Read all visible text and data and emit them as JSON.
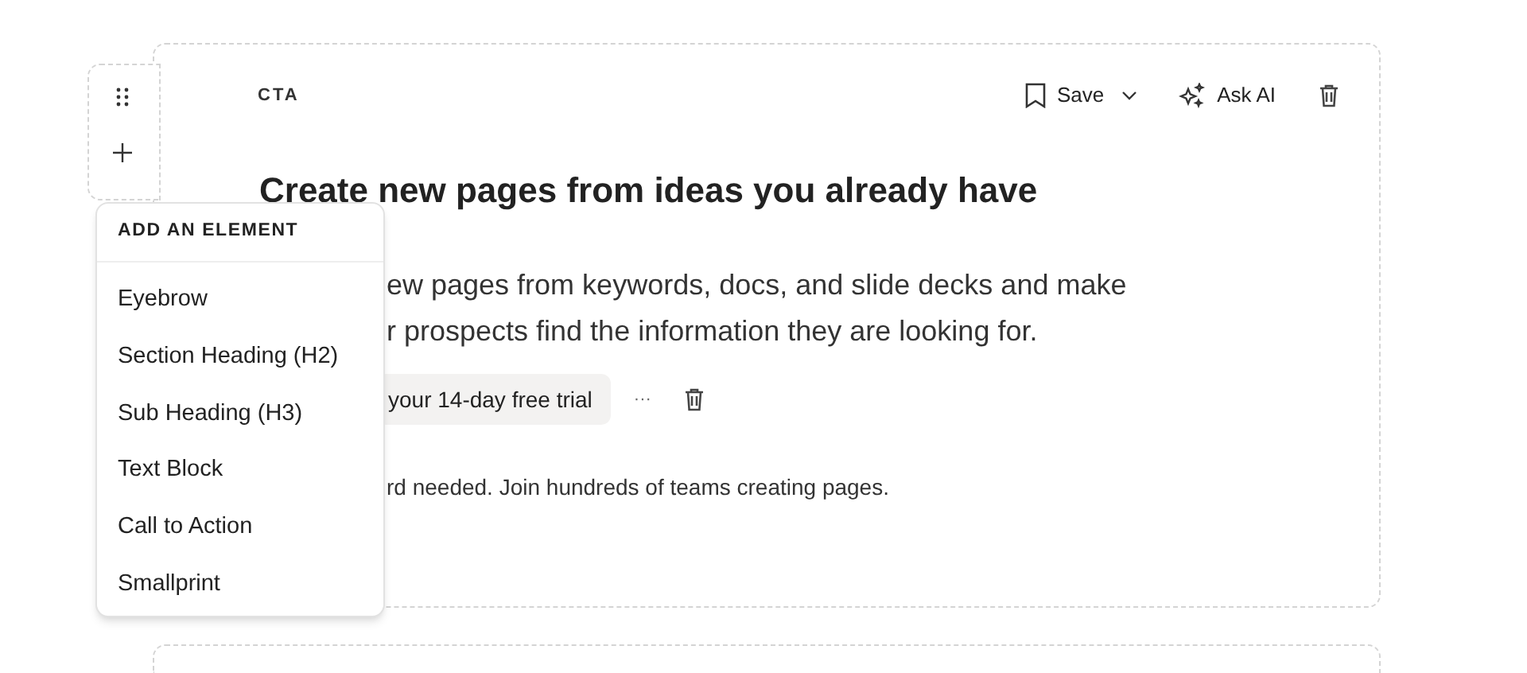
{
  "block": {
    "label": "CTA",
    "toolbar": [
      {
        "kind": "save",
        "label": "Save"
      },
      {
        "kind": "ai",
        "label": "Ask AI"
      },
      {
        "kind": "delete"
      }
    ],
    "heading": "Create new pages from ideas you already have",
    "body_lines": [
      "ew pages from keywords, docs, and slide decks and make",
      "r prospects find the information they are looking for."
    ],
    "cta": {
      "label": "your 14-day free trial",
      "more": "···"
    },
    "smallprint": "rd needed. Join hundreds of teams creating pages."
  },
  "menu": {
    "title": "ADD AN ELEMENT",
    "items": [
      "Eyebrow",
      "Section Heading (H2)",
      "Sub Heading (H3)",
      "Text Block",
      "Call to Action",
      "Smallprint"
    ]
  }
}
